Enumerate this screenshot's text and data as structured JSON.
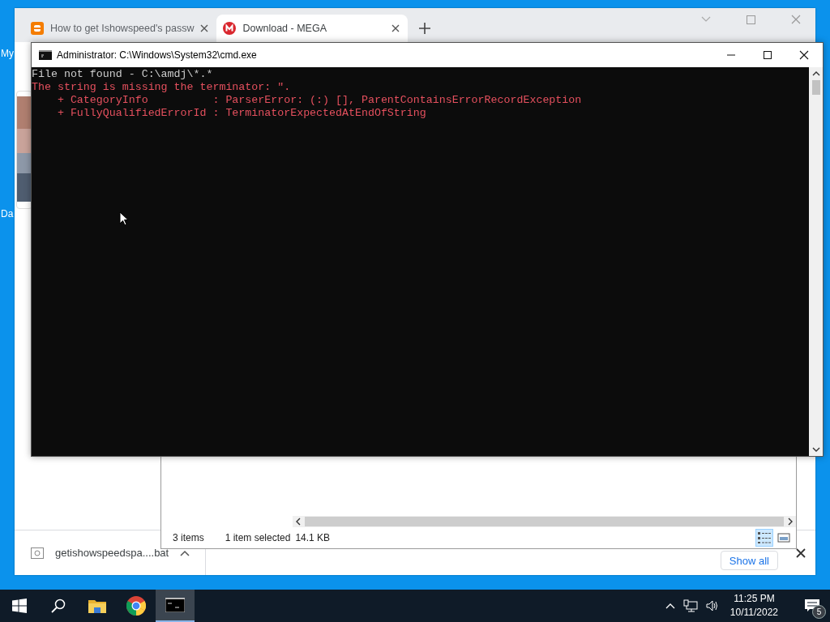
{
  "desktop": {
    "icons": [
      {
        "label": "My"
      },
      {
        "label": "Da"
      }
    ]
  },
  "browser": {
    "tabs": [
      {
        "title": "How to get Ishowspeed's passw",
        "selected": false,
        "kind": "blog"
      },
      {
        "title": "Download - MEGA",
        "selected": true,
        "kind": "mega"
      }
    ],
    "downloads": {
      "items": [
        {
          "filename": "getishowspeedspa....bat"
        }
      ],
      "show_all": "Show all"
    }
  },
  "explorer": {
    "status": {
      "item_count": "3 items",
      "selection": "1 item selected",
      "size": "14.1 KB"
    },
    "views": [
      {
        "kind": "details",
        "selected": true
      },
      {
        "kind": "thumbnails",
        "selected": false
      }
    ]
  },
  "console": {
    "title": "Administrator: C:\\Windows\\System32\\cmd.exe",
    "lines": [
      {
        "kind": "output",
        "text": "File not found - C:\\amdj\\*.*"
      },
      {
        "kind": "error",
        "text": "The string is missing the terminator: \"."
      },
      {
        "kind": "error",
        "text": "    + CategoryInfo          : ParserError: (:) [], ParentContainsErrorRecordException"
      },
      {
        "kind": "error",
        "text": "    + FullyQualifiedErrorId : TerminatorExpectedAtEndOfString"
      }
    ]
  },
  "taskbar": {
    "items": [
      {
        "kind": "start",
        "active": false
      },
      {
        "kind": "search",
        "active": false
      },
      {
        "kind": "explorer",
        "active": false
      },
      {
        "kind": "chrome",
        "active": false
      },
      {
        "kind": "console",
        "active": true
      }
    ],
    "clock": {
      "time": "11:25 PM",
      "date": "10/11/2022"
    },
    "notifications": {
      "count": "5"
    }
  }
}
